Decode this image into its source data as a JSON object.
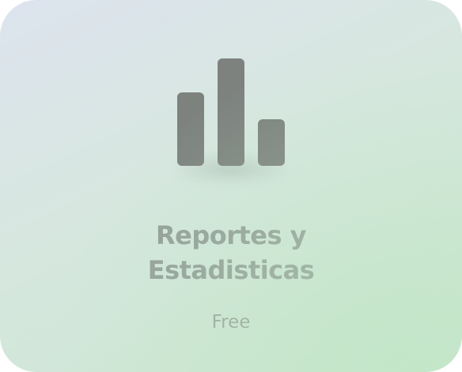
{
  "card": {
    "title_line1": "Reportes y",
    "title_line2": "Estadisticas",
    "badge": "Free",
    "icon": "bar-chart-icon",
    "colors": {
      "background_start": "#dde3ee",
      "background_end": "#c9e6cd",
      "icon": "#7d827f",
      "text": "#929c95"
    }
  }
}
